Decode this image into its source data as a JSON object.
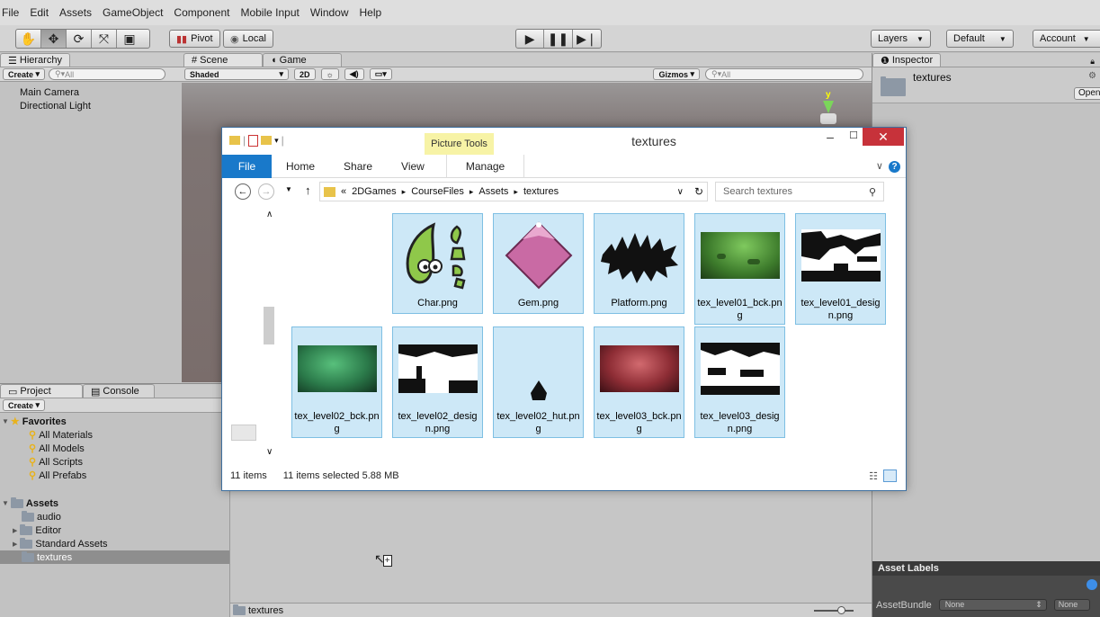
{
  "menu": [
    "File",
    "Edit",
    "Assets",
    "GameObject",
    "Component",
    "Mobile Input",
    "Window",
    "Help"
  ],
  "toolbar": {
    "transform_tools": [
      "hand-icon",
      "move-icon",
      "rotate-icon",
      "scale-icon",
      "rect-icon"
    ],
    "pivot_label": "Pivot",
    "local_label": "Local",
    "play_controls": [
      "play-icon",
      "pause-icon",
      "step-icon"
    ],
    "layers_label": "Layers",
    "layout_label": "Default",
    "account_label": "Account"
  },
  "hierarchy": {
    "tab_label": "Hierarchy",
    "create_label": "Create",
    "search_placeholder": "All",
    "items": [
      "Main Camera",
      "Directional Light"
    ]
  },
  "scene": {
    "scene_tab": "Scene",
    "game_tab": "Game",
    "shading_mode": "Shaded",
    "mode_2d": "2D",
    "gizmos_label": "Gizmos",
    "search_placeholder": "All",
    "gizmo_axis": "y"
  },
  "inspector": {
    "tab_label": "Inspector",
    "asset_name": "textures",
    "open_button": "Open",
    "asset_labels_title": "Asset Labels",
    "assetbundle_label": "AssetBundle",
    "assetbundle_value": "None",
    "assetbundle_variant": "None"
  },
  "project": {
    "project_tab": "Project",
    "console_tab": "Console",
    "create_label": "Create",
    "favorites_label": "Favorites",
    "favorites": [
      "All Materials",
      "All Models",
      "All Scripts",
      "All Prefabs"
    ],
    "assets_label": "Assets",
    "assets": [
      "audio",
      "Editor",
      "Standard Assets",
      "textures"
    ],
    "selected_asset": "textures",
    "path_label": "textures"
  },
  "explorer": {
    "title": "textures",
    "context_tab_group": "Picture Tools",
    "ribbon_tabs": [
      "File",
      "Home",
      "Share",
      "View",
      "Manage"
    ],
    "breadcrumb": [
      "2DGames",
      "CourseFiles",
      "Assets",
      "textures"
    ],
    "breadcrumb_prefix": "«",
    "search_placeholder": "Search textures",
    "status_items": "11 items",
    "status_selected": "11 items selected  5.88 MB",
    "files": [
      {
        "name": "Char.png",
        "kind": "char"
      },
      {
        "name": "Gem.png",
        "kind": "gem"
      },
      {
        "name": "Platform.png",
        "kind": "platform"
      },
      {
        "name": "tex_level01_bck.png",
        "kind": "bck_green"
      },
      {
        "name": "tex_level01_design.png",
        "kind": "design"
      },
      {
        "name": "tex_level02_bck.png",
        "kind": "bck_green2"
      },
      {
        "name": "tex_level02_design.png",
        "kind": "design2"
      },
      {
        "name": "tex_level02_hut.png",
        "kind": "hut"
      },
      {
        "name": "tex_level03_bck.png",
        "kind": "bck_red"
      },
      {
        "name": "tex_level03_design.png",
        "kind": "design3"
      }
    ]
  },
  "colors": {
    "unity_bg": "#c2c2c2",
    "scene_bg": "#7a6e6c",
    "selection_blue": "#cde8f7",
    "ribbon_file_blue": "#1979ca",
    "picture_tools_yellow": "#f7f3a6"
  }
}
